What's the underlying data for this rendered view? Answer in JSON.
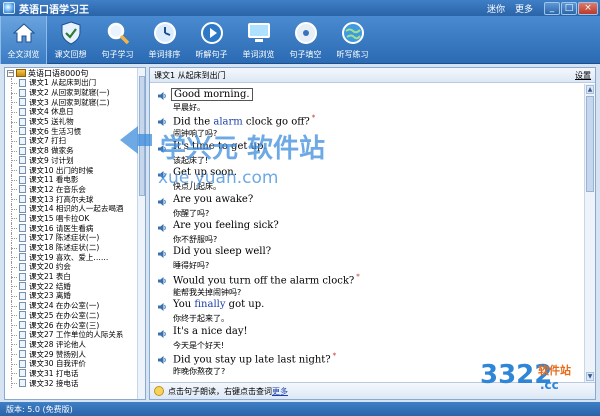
{
  "window": {
    "title": "英语口语学习王",
    "links": [
      "迷你",
      "更多"
    ],
    "buttons": [
      "_",
      "□",
      "×"
    ]
  },
  "toolbar": {
    "items": [
      {
        "label": "全文浏览",
        "icon": "home-icon"
      },
      {
        "label": "课文回想",
        "icon": "shield-check-icon"
      },
      {
        "label": "句子学习",
        "icon": "magnifier-icon"
      },
      {
        "label": "单词排序",
        "icon": "clock-icon"
      },
      {
        "label": "听解句子",
        "icon": "play-icon"
      },
      {
        "label": "单词浏览",
        "icon": "monitor-icon"
      },
      {
        "label": "句子填空",
        "icon": "disc-icon"
      },
      {
        "label": "听写练习",
        "icon": "globe-icon"
      }
    ]
  },
  "sidebar": {
    "root": "英语口语8000句",
    "items": [
      "课文1 从起床到出门",
      "课文2 从回家到就寝(一)",
      "课文3 从回家到就寝(二)",
      "课文4 休息日",
      "课文5 送礼物",
      "课文6 生活习惯",
      "课文7 打扫",
      "课文8 做家务",
      "课文9 讨计划",
      "课文10 出门的时候",
      "课文11 看电影",
      "课文12 在音乐会",
      "课文13 打高尔夫球",
      "课文14 相识的人一起去喝酒",
      "课文15 唱卡拉OK",
      "课文16 请医生看病",
      "课文17 陈述症状(一)",
      "课文18 陈述症状(二)",
      "课文19 喜欢、爱上……",
      "课文20 约会",
      "课文21 表白",
      "课文22 结婚",
      "课文23 离婚",
      "课文24 在办公室(一)",
      "课文25 在办公室(二)",
      "课文26 在办公室(三)",
      "课文27 工作单位的人际关系",
      "课文28 评论他人",
      "课文29 赞扬别人",
      "课文30 自我评价",
      "课文31 打电话",
      "课文32 接电话"
    ]
  },
  "main": {
    "lesson_title": "课文1 从起床到出门",
    "settings": "设置",
    "sentences": [
      {
        "pre": "Good morning.",
        "kw": "",
        "post": "",
        "star": false,
        "zh": "早晨好。"
      },
      {
        "pre": "Did the ",
        "kw": "alarm",
        "post": " clock go off?",
        "star": true,
        "zh": "闹钟响了吗?"
      },
      {
        "pre": "It's time to get up.",
        "kw": "",
        "post": "",
        "star": false,
        "zh": "该起床了!"
      },
      {
        "pre": "Get up soon.",
        "kw": "",
        "post": "",
        "star": false,
        "zh": "快点儿起床。"
      },
      {
        "pre": "Are you awake?",
        "kw": "",
        "post": "",
        "star": false,
        "zh": "你醒了吗?"
      },
      {
        "pre": "Are you feeling sick?",
        "kw": "",
        "post": "",
        "star": false,
        "zh": "你不舒服吗?"
      },
      {
        "pre": "Did you sleep well?",
        "kw": "",
        "post": "",
        "star": false,
        "zh": "睡得好吗?"
      },
      {
        "pre": "Would you turn off the alarm clock?",
        "kw": "",
        "post": "",
        "star": true,
        "zh": "能帮我关掉闹钟吗?"
      },
      {
        "pre": "You ",
        "kw": "finally",
        "post": " got up.",
        "star": false,
        "zh": "你终于起来了。"
      },
      {
        "pre": "It's a nice day!",
        "kw": "",
        "post": "",
        "star": false,
        "zh": "今天是个好天!"
      },
      {
        "pre": "Did you stay up late last night?",
        "kw": "",
        "post": "",
        "star": true,
        "zh": "昨晚你熬夜了?"
      }
    ],
    "hint": "点击句子朗读，右键点击查词",
    "hint_more": "更多"
  },
  "status": {
    "version": "版本: 5.0  (免费版)"
  },
  "watermark": {
    "main": "学兴元 软件站",
    "sub": "xue.yuan.com",
    "brand_num": "3322",
    "brand_txt": "软件站",
    "brand_cc": ".cc"
  }
}
